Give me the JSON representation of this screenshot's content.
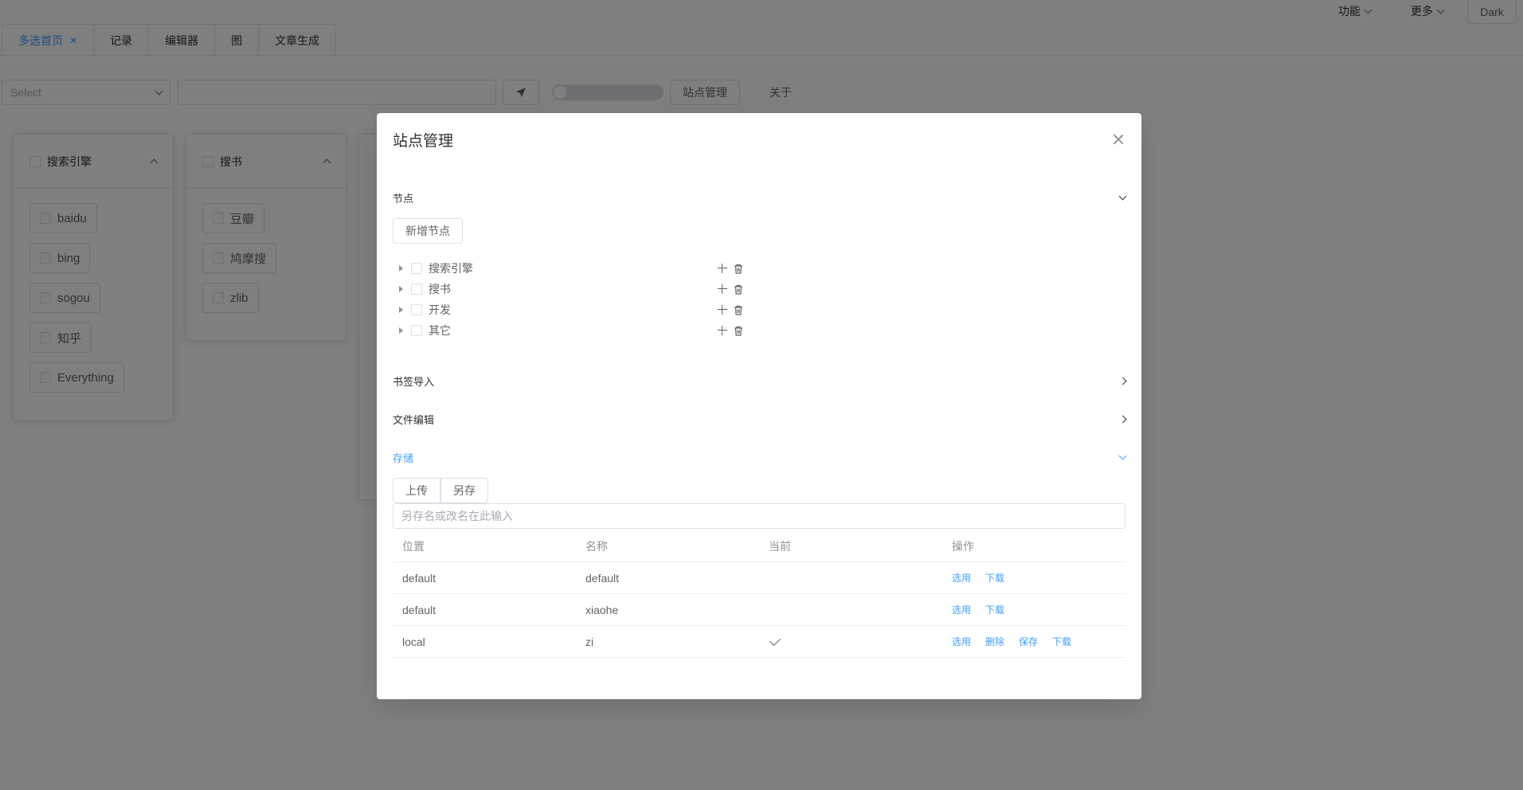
{
  "topbar": {
    "menus": [
      {
        "label": "功能"
      },
      {
        "label": "更多"
      }
    ],
    "theme_button": "Dark"
  },
  "tabs": [
    {
      "label": "多选首页",
      "active": true
    },
    {
      "label": "记录"
    },
    {
      "label": "编辑器"
    },
    {
      "label": "图"
    },
    {
      "label": "文章生成"
    }
  ],
  "toolbar": {
    "select_placeholder": "Select",
    "site_manage": "站点管理",
    "about": "关于"
  },
  "cards": [
    {
      "title": "搜索引擎",
      "items": [
        "baidu",
        "bing",
        "sogou",
        "知乎",
        "Everything"
      ]
    },
    {
      "title": "搜书",
      "items": [
        "豆瓣",
        "鸠摩搜",
        "zlib"
      ]
    }
  ],
  "dialog": {
    "title": "站点管理",
    "sections": {
      "nodes": {
        "title": "节点",
        "add_button": "新增节点",
        "tree": [
          "搜索引擎",
          "搜书",
          "开发",
          "其它"
        ]
      },
      "bookmark_import": {
        "title": "书签导入"
      },
      "file_edit": {
        "title": "文件编辑"
      },
      "storage": {
        "title": "存储",
        "upload_button": "上传",
        "save_as_button": "另存",
        "rename_placeholder": "另存名或改名在此输入",
        "columns": [
          "位置",
          "名称",
          "当前",
          "操作"
        ],
        "rows": [
          {
            "location": "default",
            "name": "default",
            "current": false,
            "actions": [
              "选用",
              "下载"
            ]
          },
          {
            "location": "default",
            "name": "xiaohe",
            "current": false,
            "actions": [
              "选用",
              "下载"
            ]
          },
          {
            "location": "local",
            "name": "zi",
            "current": true,
            "actions": [
              "选用",
              "删除",
              "保存",
              "下载"
            ]
          }
        ]
      }
    }
  },
  "colors": {
    "accent": "#409eff",
    "border": "#dcdfe6",
    "overlay": "rgba(0,0,0,0.5)"
  }
}
